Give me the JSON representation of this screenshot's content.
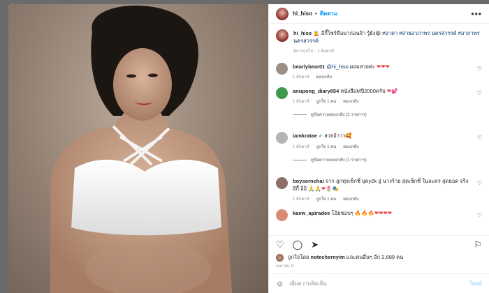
{
  "header": {
    "username": "hi_hiso",
    "dot": "•",
    "follow_label": "ติดตาม",
    "more_icon": "more-horizontal-icon"
  },
  "caption": {
    "username": "hi_hiso",
    "text": "🧝 อีกี้ไซร์คือมาก่อนจ้า รู้ยัง😆",
    "tags": "#อาดา #สายอาภาพร นครสวรรค์ #อาภาพรนครสวรรค์",
    "meta": "มีการแก้ไข · 1 สัปดาห์"
  },
  "comments": [
    {
      "username": "bearlybear01",
      "mention": "@hi_hiso",
      "text": " ผอมสวยค่ะ",
      "emojis": "❤❤❤",
      "time": "1 สัปดาห์",
      "likes": "",
      "reply": "ตอบกลับ",
      "view_replies": "",
      "avatar_color": "#9b8f86"
    },
    {
      "username": "anupong_diary654",
      "mention": "",
      "text": " หนังสือMปี2000ครับ",
      "emojis": "❤💕",
      "time": "1 สัปดาห์",
      "likes": "ถูกใจ 1 คน",
      "reply": "ตอบกลับ",
      "view_replies": "ดูข้อความตอบกลับ (2 รายการ)",
      "avatar_color": "#3c9a4a"
    },
    {
      "username": "iamkratae",
      "mention": "",
      "text": " สวยอ้าาา🥰",
      "emojis": "",
      "time": "1 สัปดาห์",
      "likes": "ถูกใจ 1 คน",
      "reply": "ตอบกลับ",
      "view_replies": "ดูข้อความตอบกลับ (1 รายการ)",
      "avatar_color": "#b5b5b5"
    },
    {
      "username": "boysornchai",
      "mention": "",
      "text": " จาก ลูกทุ่งเซ็กซี่ ยุคy2k สู่ นางร้าย สุดเซ็กซี่ ในละคร สุดยอด จริงอีกี้ อิอิ",
      "emojis": "🙏🙏❤🌷🎭",
      "time": "1 สัปดาห์",
      "likes": "ถูกใจ 1 คน",
      "reply": "ตอบกลับ",
      "view_replies": "",
      "avatar_color": "#8b6f66"
    },
    {
      "username": "kaew_apiradee",
      "mention": "",
      "text": " โอ้ยชอบๆ",
      "emojis": "🔥🔥🔥❤❤❤❤",
      "time": "",
      "likes": "",
      "reply": "",
      "view_replies": "",
      "avatar_color": "#d88b72"
    }
  ],
  "actions": {
    "like_icon": "heart-icon",
    "comment_icon": "comment-icon",
    "share_icon": "paper-plane-icon",
    "save_icon": "bookmark-icon"
  },
  "likes": {
    "prefix": "ถูกใจโดย ",
    "user": "notechernyim",
    "suffix": " และคนอื่นๆ อีก 2,689 คน"
  },
  "date": "เมษายน 11",
  "add_comment": {
    "placeholder": "เพิ่มความคิดเห็น",
    "post_label": "โพสต์",
    "emoji_icon": "smiley-icon"
  }
}
